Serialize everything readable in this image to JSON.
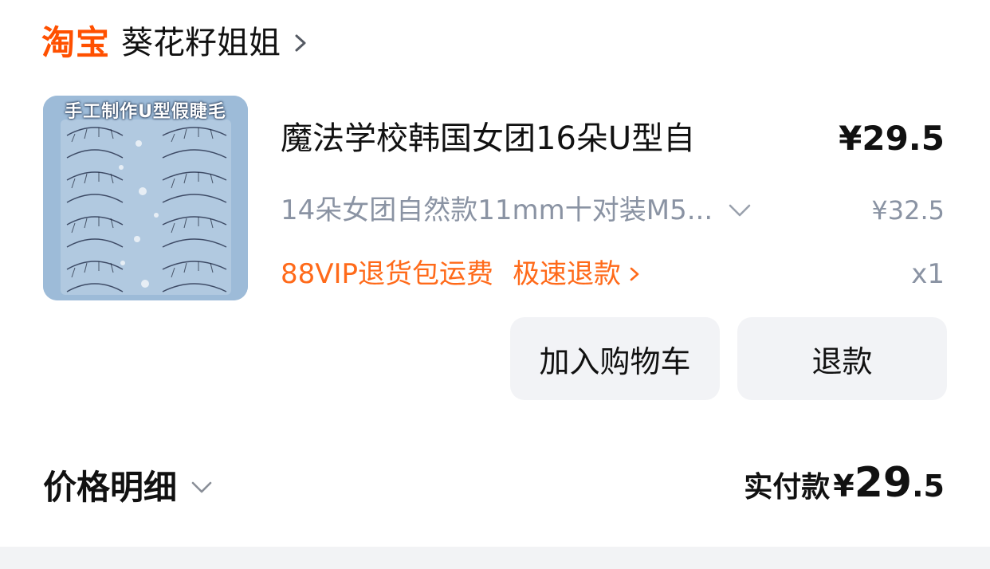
{
  "store": {
    "platform": "淘宝",
    "name": "葵花籽姐姐"
  },
  "product": {
    "image_caption": "手工制作U型假睫毛",
    "title": "魔法学校韩国女团16朵U型自",
    "price": "¥29.5",
    "sku": "14朵女团自然款11mm十对装M5...",
    "original_price": "¥32.5",
    "promo_tag": "88VIP退货包运费",
    "refund_link": "极速退款",
    "quantity": "x1"
  },
  "actions": {
    "add_to_cart": "加入购物车",
    "refund": "退款"
  },
  "summary": {
    "detail_label": "价格明细",
    "paid_label": "实付款",
    "paid_currency": "¥",
    "paid_integer": "29",
    "paid_decimal": ".5"
  },
  "colors": {
    "accent": "#FF5000",
    "promo": "#FF6A1A",
    "muted": "#8a93a3",
    "button_bg": "#f2f3f6"
  }
}
